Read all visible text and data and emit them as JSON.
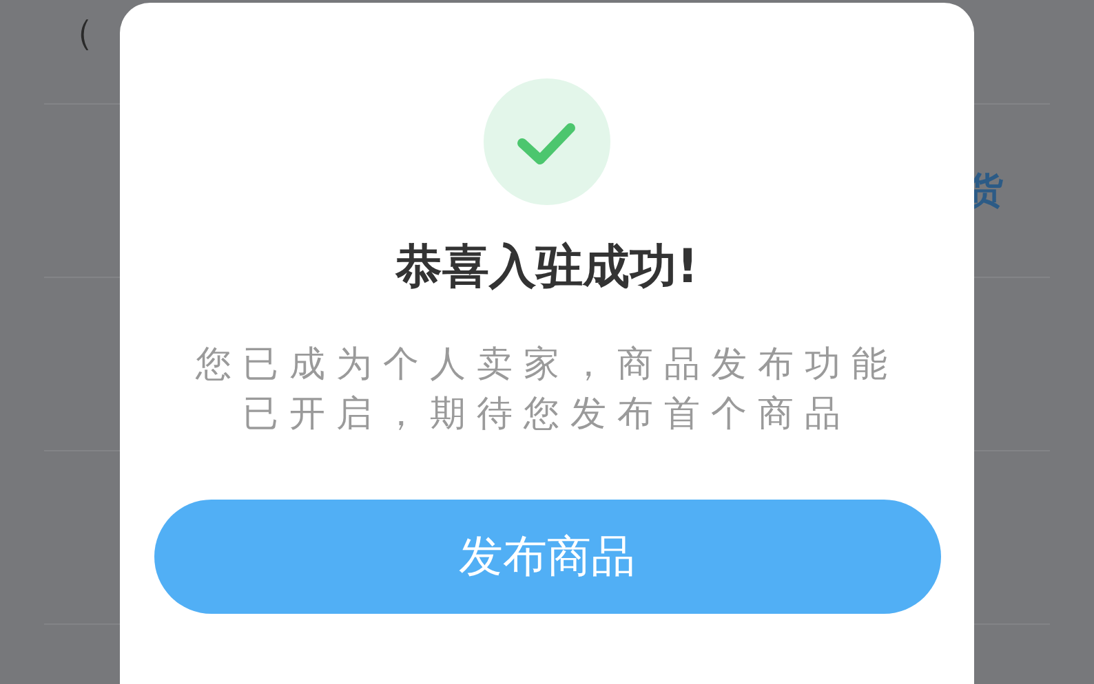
{
  "background": {
    "rows": [
      {
        "left_text": "（"
      },
      {
        "right_text": "货"
      },
      {},
      {}
    ]
  },
  "dialog": {
    "title": "恭喜入驻成功!",
    "message": "您已成为个人卖家，商品发布功能已开启，期待您发布首个商品",
    "button": "发布商品"
  }
}
